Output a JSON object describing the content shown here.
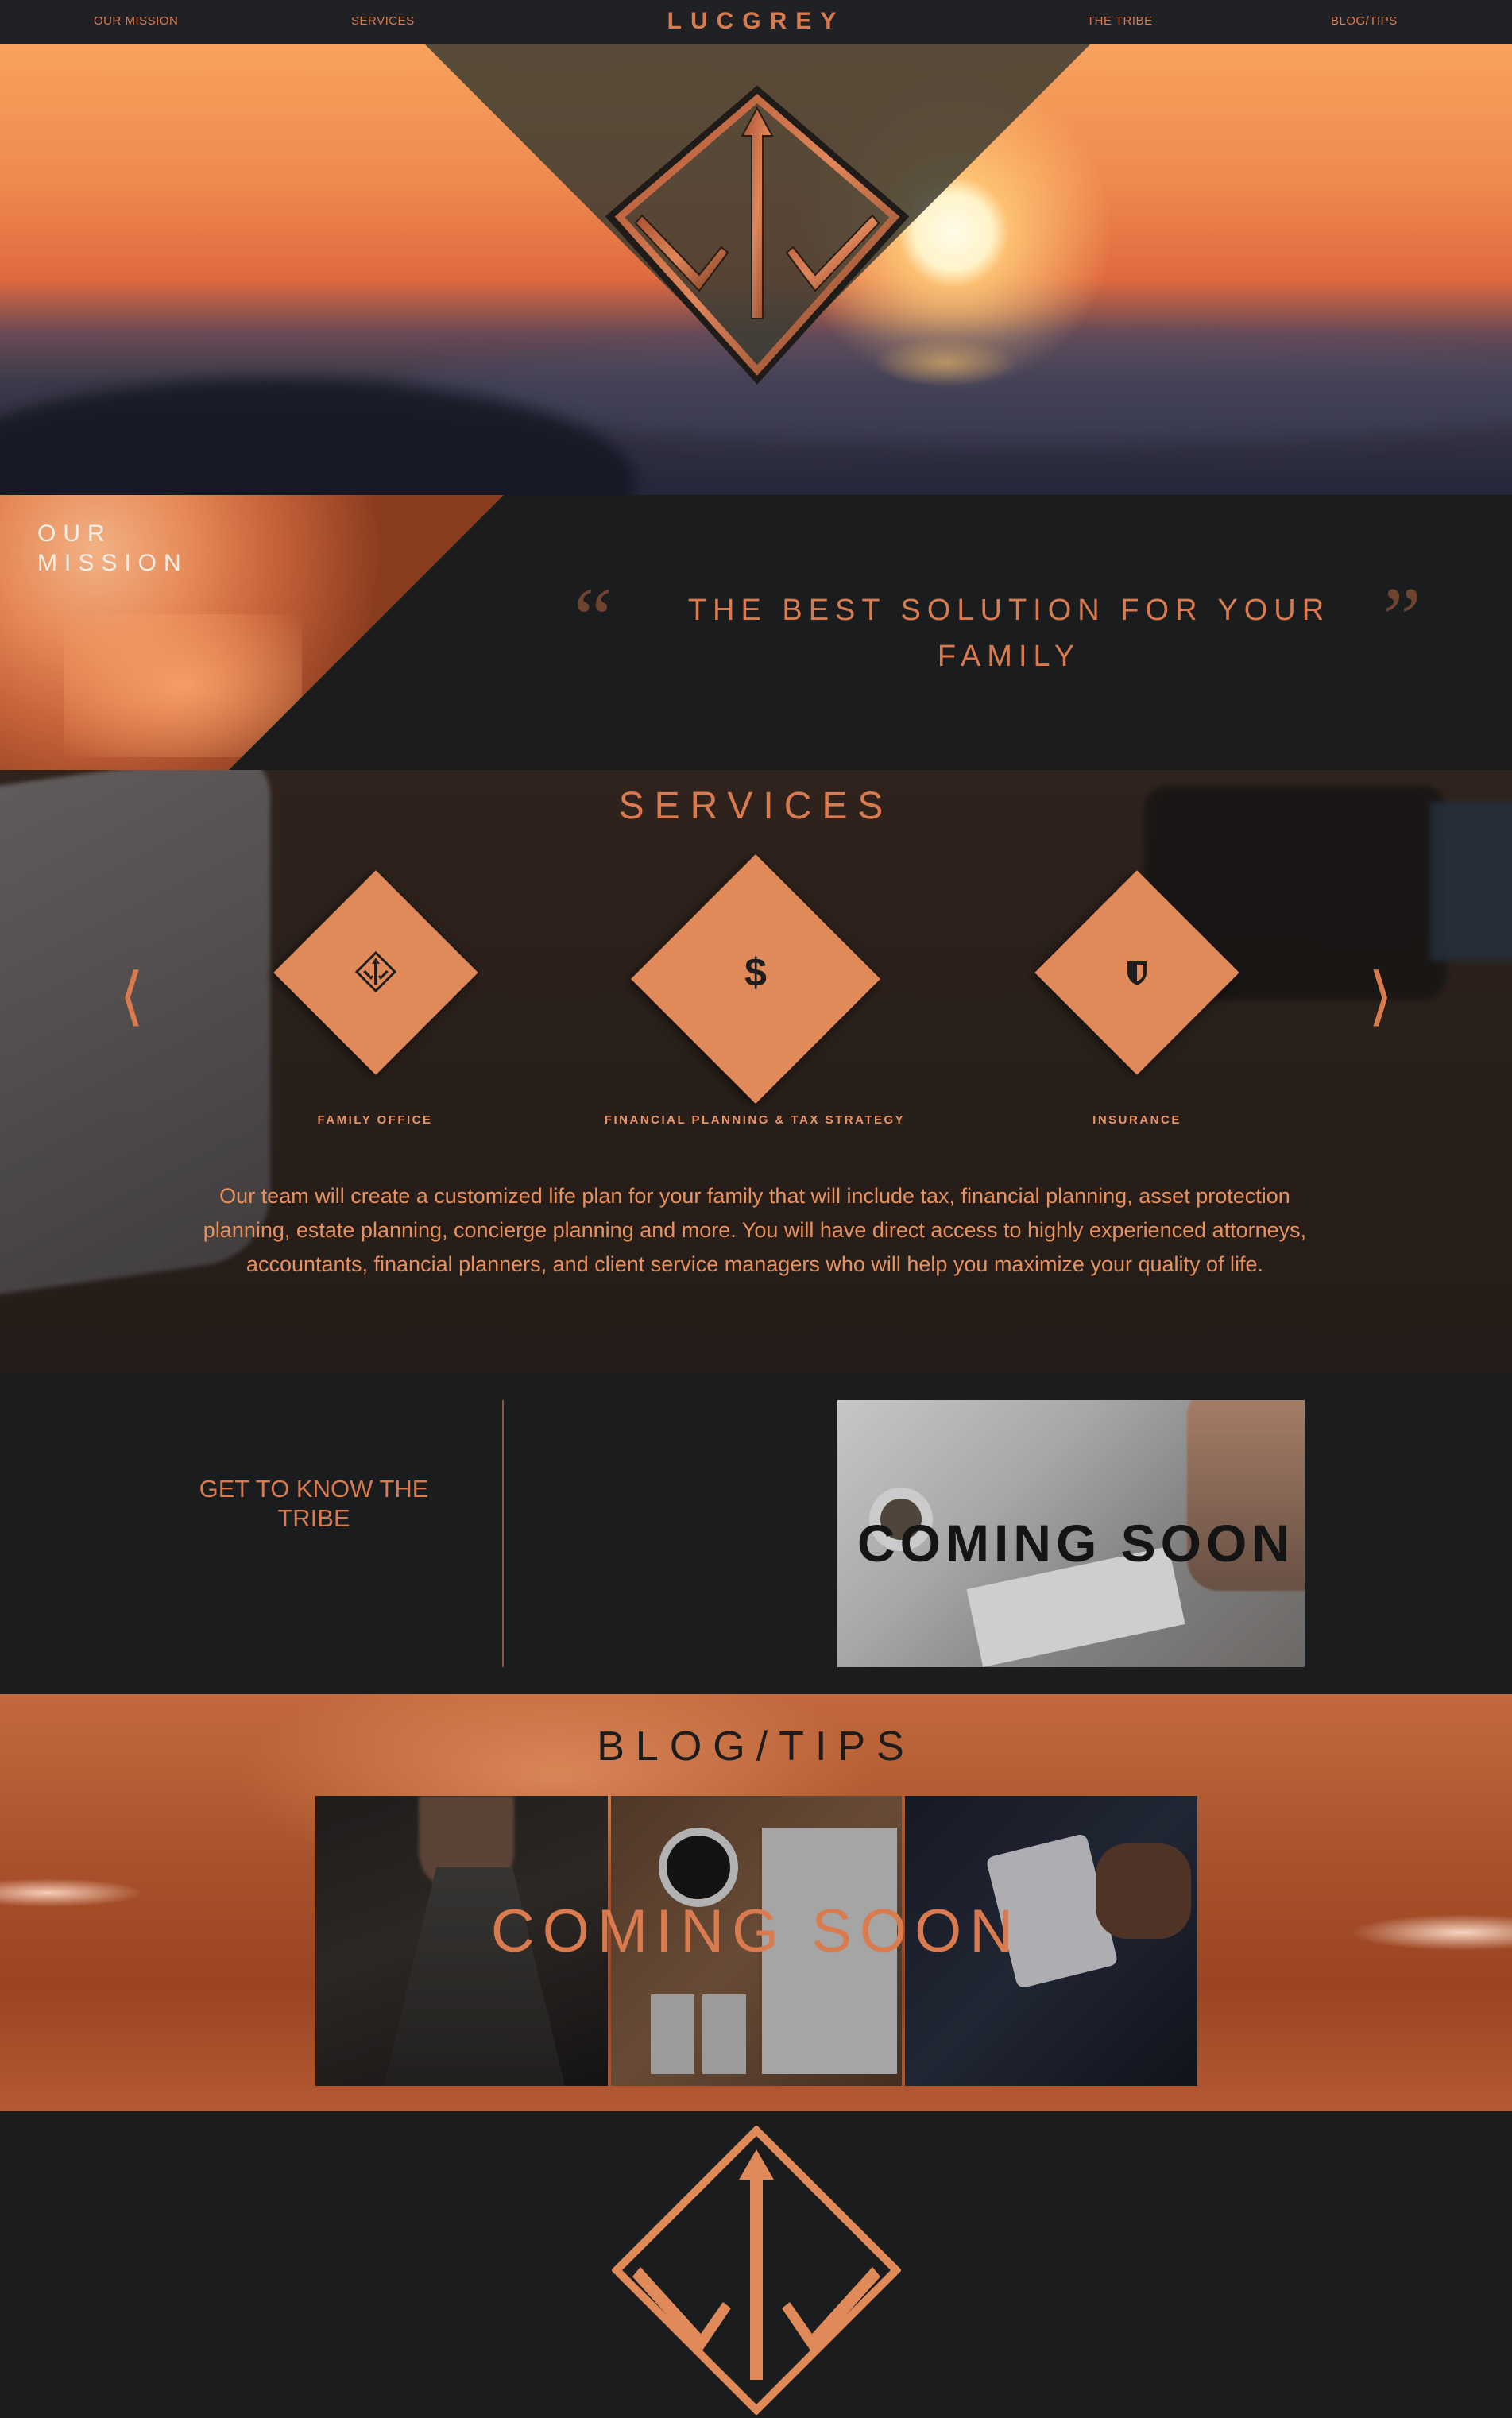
{
  "nav": {
    "brand": "LUCGREY",
    "links": [
      "OUR MISSION",
      "SERVICES",
      "THE TRIBE",
      "BLOG/TIPS"
    ]
  },
  "mission": {
    "title": "OUR MISSION",
    "quote": "THE BEST SOLUTION FOR YOUR FAMILY"
  },
  "services": {
    "title": "SERVICES",
    "items": [
      {
        "label": "FAMILY OFFICE",
        "icon": "logo-icon"
      },
      {
        "label": "FINANCIAL PLANNING & TAX STRATEGY",
        "icon": "dollar-icon"
      },
      {
        "label": "INSURANCE",
        "icon": "shield-icon"
      }
    ],
    "description": "Our team will create a customized life plan for your family that will include tax, financial planning, asset protection planning, estate planning, concierge planning and more. You will have direct access to highly experienced attorneys, accountants, financial planners, and client service managers who will help you maximize your quality of life."
  },
  "tribe": {
    "link": "GET TO KNOW THE TRIBE",
    "coming_soon": "COMING SOON"
  },
  "blog": {
    "title": "BLOG/TIPS",
    "coming_soon": "COMING SOON"
  },
  "colors": {
    "accent": "#d97a4f",
    "background": "#1b1c1e",
    "nav": "#202124"
  }
}
